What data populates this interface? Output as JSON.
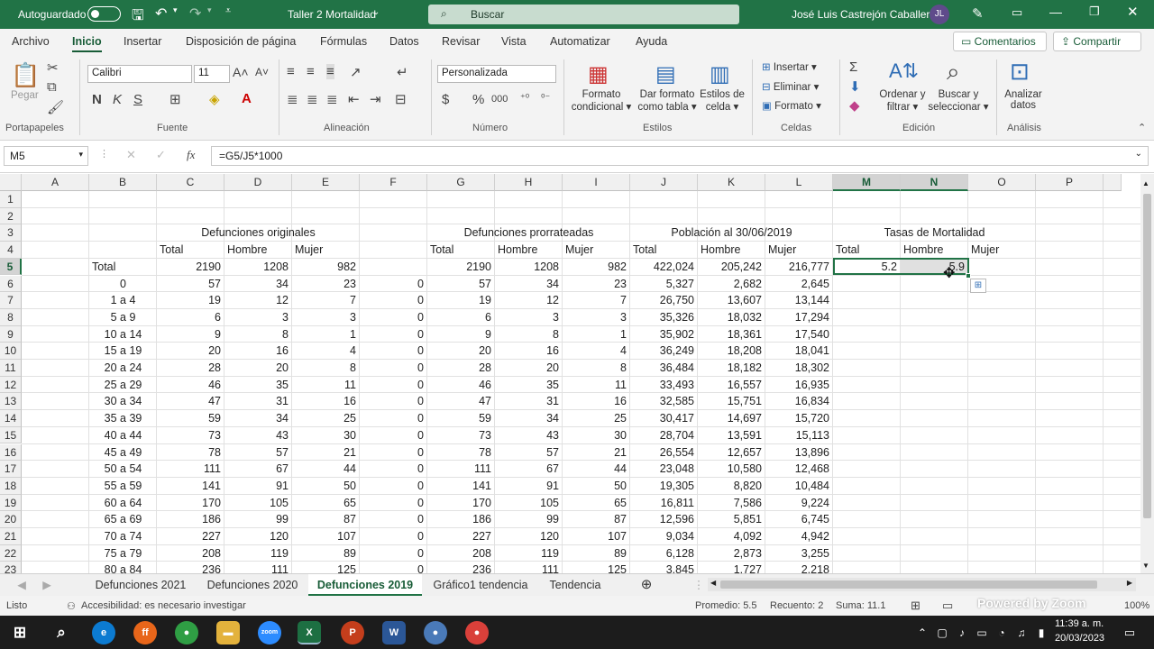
{
  "titlebar": {
    "autosave": "Autoguardado",
    "doc_title": "Taller 2 Mortalidad",
    "search": "Buscar",
    "user": "José Luis Castrejón Caballero",
    "initials": "JL"
  },
  "menu": {
    "tabs": [
      "Archivo",
      "Inicio",
      "Insertar",
      "Disposición de página",
      "Fórmulas",
      "Datos",
      "Revisar",
      "Vista",
      "Automatizar",
      "Ayuda"
    ],
    "comments": "Comentarios",
    "share": "Compartir"
  },
  "ribbon": {
    "clipboard": {
      "paste": "Pegar",
      "group": "Portapapeles"
    },
    "font": {
      "name": "Calibri",
      "size": "11",
      "bold": "N",
      "italic": "K",
      "underline": "S",
      "group": "Fuente"
    },
    "alignment": {
      "group": "Alineación"
    },
    "number": {
      "format": "Personalizada",
      "currency": "$",
      "percent": "%",
      "thousands": "000",
      "group": "Número"
    },
    "styles": {
      "cond1": "Formato",
      "cond2": "condicional",
      "table1": "Dar formato",
      "table2": "como tabla",
      "cell1": "Estilos de",
      "cell2": "celda",
      "group": "Estilos"
    },
    "cells": {
      "insert": "Insertar",
      "delete": "Eliminar",
      "format": "Formato",
      "group": "Celdas"
    },
    "editing": {
      "sort1": "Ordenar y",
      "sort2": "filtrar",
      "find1": "Buscar y",
      "find2": "seleccionar",
      "group": "Edición"
    },
    "analysis": {
      "an1": "Analizar",
      "an2": "datos",
      "group": "Análisis"
    }
  },
  "formula_bar": {
    "name_box": "M5",
    "fx": "fx",
    "formula": "=G5/J5*1000"
  },
  "columns": [
    "A",
    "B",
    "C",
    "D",
    "E",
    "F",
    "G",
    "H",
    "I",
    "J",
    "K",
    "L",
    "M",
    "N",
    "O",
    "P"
  ],
  "rows": [
    "1",
    "2",
    "3",
    "4",
    "5",
    "6",
    "7",
    "8",
    "9",
    "10",
    "11",
    "12",
    "13",
    "14",
    "15",
    "16",
    "17",
    "18",
    "19",
    "20",
    "21",
    "22",
    "23"
  ],
  "headers": {
    "orig": "Defunciones originales",
    "prorr": "Defunciones prorrateadas",
    "pob": "Población al 30/06/2019",
    "tasas": "Tasas de Mortalidad",
    "total": "Total",
    "hombre": "Hombre",
    "mujer": "Mujer"
  },
  "table": [
    [
      "Total",
      "2190",
      "1208",
      "982",
      "",
      "2190",
      "1208",
      "982",
      "422,024",
      "205,242",
      "216,777",
      "5.2",
      "5.9"
    ],
    [
      "0",
      "57",
      "34",
      "23",
      "0",
      "57",
      "34",
      "23",
      "5,327",
      "2,682",
      "2,645",
      "",
      ""
    ],
    [
      "1 a 4",
      "19",
      "12",
      "7",
      "0",
      "19",
      "12",
      "7",
      "26,750",
      "13,607",
      "13,144",
      "",
      ""
    ],
    [
      "5 a 9",
      "6",
      "3",
      "3",
      "0",
      "6",
      "3",
      "3",
      "35,326",
      "18,032",
      "17,294",
      "",
      ""
    ],
    [
      "10 a 14",
      "9",
      "8",
      "1",
      "0",
      "9",
      "8",
      "1",
      "35,902",
      "18,361",
      "17,540",
      "",
      ""
    ],
    [
      "15 a 19",
      "20",
      "16",
      "4",
      "0",
      "20",
      "16",
      "4",
      "36,249",
      "18,208",
      "18,041",
      "",
      ""
    ],
    [
      "20 a 24",
      "28",
      "20",
      "8",
      "0",
      "28",
      "20",
      "8",
      "36,484",
      "18,182",
      "18,302",
      "",
      ""
    ],
    [
      "25 a 29",
      "46",
      "35",
      "11",
      "0",
      "46",
      "35",
      "11",
      "33,493",
      "16,557",
      "16,935",
      "",
      ""
    ],
    [
      "30 a 34",
      "47",
      "31",
      "16",
      "0",
      "47",
      "31",
      "16",
      "32,585",
      "15,751",
      "16,834",
      "",
      ""
    ],
    [
      "35 a 39",
      "59",
      "34",
      "25",
      "0",
      "59",
      "34",
      "25",
      "30,417",
      "14,697",
      "15,720",
      "",
      ""
    ],
    [
      "40 a 44",
      "73",
      "43",
      "30",
      "0",
      "73",
      "43",
      "30",
      "28,704",
      "13,591",
      "15,113",
      "",
      ""
    ],
    [
      "45 a 49",
      "78",
      "57",
      "21",
      "0",
      "78",
      "57",
      "21",
      "26,554",
      "12,657",
      "13,896",
      "",
      ""
    ],
    [
      "50 a 54",
      "111",
      "67",
      "44",
      "0",
      "111",
      "67",
      "44",
      "23,048",
      "10,580",
      "12,468",
      "",
      ""
    ],
    [
      "55 a 59",
      "141",
      "91",
      "50",
      "0",
      "141",
      "91",
      "50",
      "19,305",
      "8,820",
      "10,484",
      "",
      ""
    ],
    [
      "60 a 64",
      "170",
      "105",
      "65",
      "0",
      "170",
      "105",
      "65",
      "16,811",
      "7,586",
      "9,224",
      "",
      ""
    ],
    [
      "65 a 69",
      "186",
      "99",
      "87",
      "0",
      "186",
      "99",
      "87",
      "12,596",
      "5,851",
      "6,745",
      "",
      ""
    ],
    [
      "70 a 74",
      "227",
      "120",
      "107",
      "0",
      "227",
      "120",
      "107",
      "9,034",
      "4,092",
      "4,942",
      "",
      ""
    ],
    [
      "75 a 79",
      "208",
      "119",
      "89",
      "0",
      "208",
      "119",
      "89",
      "6,128",
      "2,873",
      "3,255",
      "",
      ""
    ],
    [
      "80 a 84",
      "236",
      "111",
      "125",
      "0",
      "236",
      "111",
      "125",
      "3,845",
      "1,727",
      "2,218",
      "",
      ""
    ]
  ],
  "sheet_tabs": [
    "Defunciones 2021",
    "Defunciones 2020",
    "Defunciones 2019",
    "Gráfico1 tendencia",
    "Tendencia"
  ],
  "status": {
    "ready": "Listo",
    "accessibility": "Accesibilidad: es necesario investigar",
    "avg": "Promedio: 5.5",
    "count": "Recuento: 2",
    "sum": "Suma: 11.1",
    "zoom": "100%",
    "watermark": "Powered by Zoom"
  },
  "taskbar": {
    "time": "11:39 a. m.",
    "date": "20/03/2023"
  }
}
